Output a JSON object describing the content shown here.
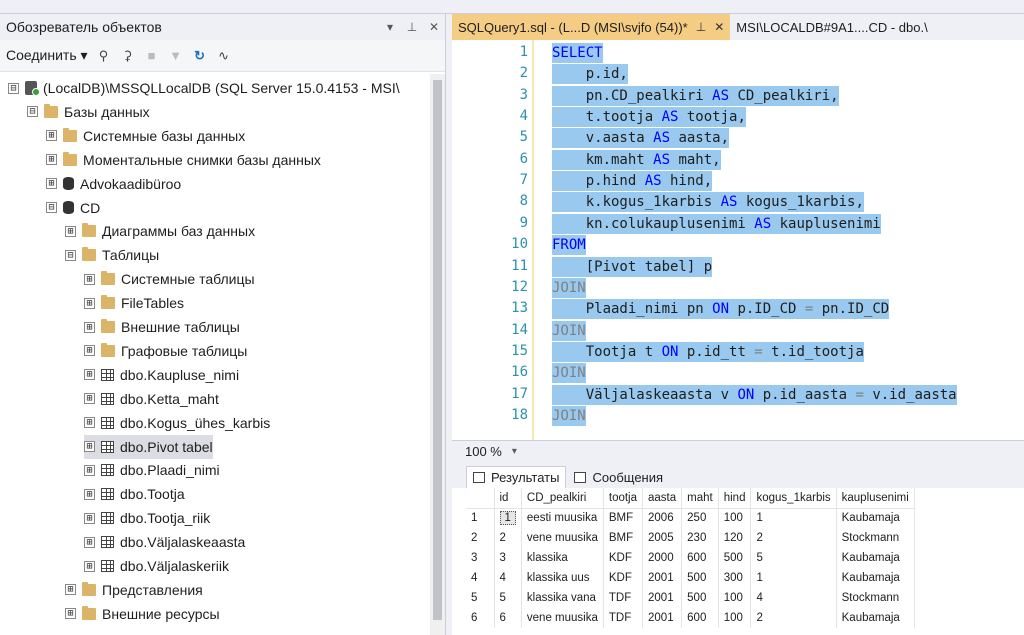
{
  "object_explorer": {
    "title": "Обозреватель объектов",
    "title_controls": [
      "▾",
      "⊥",
      "✕"
    ],
    "toolbar": {
      "connect_label": "Соединить ▾"
    },
    "tree": [
      {
        "label": "(LocalDB)\\MSSQLLocalDB (SQL Server 15.0.4153 - MSI\\",
        "icon": "server-icon",
        "exp": "⊟",
        "indent": 0
      },
      {
        "label": "Базы данных",
        "icon": "folder-icon",
        "exp": "⊟",
        "indent": 1
      },
      {
        "label": "Системные базы данных",
        "icon": "folder-icon",
        "exp": "⊞",
        "indent": 2
      },
      {
        "label": "Моментальные снимки базы данных",
        "icon": "folder-icon",
        "exp": "⊞",
        "indent": 2
      },
      {
        "label": "Advokaadibüroo",
        "icon": "database-icon",
        "exp": "⊞",
        "indent": 2
      },
      {
        "label": "CD",
        "icon": "database-icon",
        "exp": "⊟",
        "indent": 2
      },
      {
        "label": "Диаграммы баз данных",
        "icon": "folder-icon",
        "exp": "⊞",
        "indent": 3
      },
      {
        "label": "Таблицы",
        "icon": "folder-icon",
        "exp": "⊟",
        "indent": 3
      },
      {
        "label": "Системные таблицы",
        "icon": "folder-icon",
        "exp": "⊞",
        "indent": 4
      },
      {
        "label": "FileTables",
        "icon": "folder-icon",
        "exp": "⊞",
        "indent": 4
      },
      {
        "label": "Внешние таблицы",
        "icon": "folder-icon",
        "exp": "⊞",
        "indent": 4
      },
      {
        "label": "Графовые таблицы",
        "icon": "folder-icon",
        "exp": "⊞",
        "indent": 4
      },
      {
        "label": "dbo.Kaupluse_nimi",
        "icon": "table-icon",
        "exp": "⊞",
        "indent": 4
      },
      {
        "label": "dbo.Ketta_maht",
        "icon": "table-icon",
        "exp": "⊞",
        "indent": 4
      },
      {
        "label": "dbo.Kogus_ühes_karbis",
        "icon": "table-icon",
        "exp": "⊞",
        "indent": 4
      },
      {
        "label": "dbo.Pivot tabel",
        "icon": "table-icon",
        "exp": "⊞",
        "indent": 4,
        "selected": true
      },
      {
        "label": "dbo.Plaadi_nimi",
        "icon": "table-icon",
        "exp": "⊞",
        "indent": 4
      },
      {
        "label": "dbo.Tootja",
        "icon": "table-icon",
        "exp": "⊞",
        "indent": 4
      },
      {
        "label": "dbo.Tootja_riik",
        "icon": "table-icon",
        "exp": "⊞",
        "indent": 4
      },
      {
        "label": "dbo.Väljalaskeaasta",
        "icon": "table-icon",
        "exp": "⊞",
        "indent": 4
      },
      {
        "label": "dbo.Väljalaskeriik",
        "icon": "table-icon",
        "exp": "⊞",
        "indent": 4
      },
      {
        "label": "Представления",
        "icon": "folder-icon",
        "exp": "⊞",
        "indent": 3
      },
      {
        "label": "Внешние ресурсы",
        "icon": "folder-icon",
        "exp": "⊞",
        "indent": 3
      }
    ]
  },
  "editor": {
    "tabs": [
      {
        "label": "SQLQuery1.sql - (L...D (MSI\\svjfo (54))*",
        "pin": "⊥",
        "close": "✕",
        "active": true
      },
      {
        "label": "MSI\\LOCALDB#9A1....CD - dbo.\\",
        "active": false
      }
    ],
    "lines": [
      [
        {
          "t": "SELECT",
          "c": "kw"
        }
      ],
      [
        {
          "t": "    p.id,",
          "c": ""
        }
      ],
      [
        {
          "t": "    pn.CD_pealkiri ",
          "c": ""
        },
        {
          "t": "AS",
          "c": "kw"
        },
        {
          "t": " CD_pealkiri,",
          "c": ""
        }
      ],
      [
        {
          "t": "    t.tootja ",
          "c": ""
        },
        {
          "t": "AS",
          "c": "kw"
        },
        {
          "t": " tootja,",
          "c": ""
        }
      ],
      [
        {
          "t": "    v.aasta ",
          "c": ""
        },
        {
          "t": "AS",
          "c": "kw"
        },
        {
          "t": " aasta,",
          "c": ""
        }
      ],
      [
        {
          "t": "    km.maht ",
          "c": ""
        },
        {
          "t": "AS",
          "c": "kw"
        },
        {
          "t": " maht,",
          "c": ""
        }
      ],
      [
        {
          "t": "    p.hind ",
          "c": ""
        },
        {
          "t": "AS",
          "c": "kw"
        },
        {
          "t": " hind,",
          "c": ""
        }
      ],
      [
        {
          "t": "    k.kogus_1karbis ",
          "c": ""
        },
        {
          "t": "AS",
          "c": "kw"
        },
        {
          "t": " kogus_1karbis,",
          "c": ""
        }
      ],
      [
        {
          "t": "    kn.colukauplusenimi ",
          "c": ""
        },
        {
          "t": "AS",
          "c": "kw"
        },
        {
          "t": " kauplusenimi",
          "c": ""
        }
      ],
      [
        {
          "t": "FROM",
          "c": "kw"
        }
      ],
      [
        {
          "t": "    [Pivot tabel] p",
          "c": ""
        }
      ],
      [
        {
          "t": "JOIN",
          "c": "kwg"
        }
      ],
      [
        {
          "t": "    Plaadi_nimi pn ",
          "c": ""
        },
        {
          "t": "ON",
          "c": "kw"
        },
        {
          "t": " p.ID_CD ",
          "c": ""
        },
        {
          "t": "=",
          "c": "op"
        },
        {
          "t": " pn.ID_CD",
          "c": ""
        }
      ],
      [
        {
          "t": "JOIN",
          "c": "kwg"
        }
      ],
      [
        {
          "t": "    Tootja t ",
          "c": ""
        },
        {
          "t": "ON",
          "c": "kw"
        },
        {
          "t": " p.id_tt ",
          "c": ""
        },
        {
          "t": "=",
          "c": "op"
        },
        {
          "t": " t.id_tootja",
          "c": ""
        }
      ],
      [
        {
          "t": "JOIN",
          "c": "kwg"
        }
      ],
      [
        {
          "t": "    Väljalaskeaasta v ",
          "c": ""
        },
        {
          "t": "ON",
          "c": "kw"
        },
        {
          "t": " p.id_aasta ",
          "c": ""
        },
        {
          "t": "=",
          "c": "op"
        },
        {
          "t": " v.id_aasta",
          "c": ""
        }
      ],
      [
        {
          "t": "JOIN",
          "c": "kwg"
        }
      ]
    ],
    "line_numbers": [
      "1",
      "2",
      "3",
      "4",
      "5",
      "6",
      "7",
      "8",
      "9",
      "10",
      "11",
      "12",
      "13",
      "14",
      "15",
      "16",
      "17",
      "18"
    ],
    "zoom": "100 %"
  },
  "results": {
    "tabs": [
      {
        "label": "Результаты",
        "active": true,
        "icon": "grid-icon"
      },
      {
        "label": "Сообщения",
        "active": false,
        "icon": "messages-icon"
      }
    ],
    "columns": [
      "id",
      "CD_pealkiri",
      "tootja",
      "aasta",
      "maht",
      "hind",
      "kogus_1karbis",
      "kauplusenimi"
    ],
    "rows": [
      [
        "1",
        "1",
        "eesti muusika",
        "BMF",
        "2006",
        "250",
        "100",
        "1",
        "Kaubamaja"
      ],
      [
        "2",
        "2",
        "vene muusika",
        "BMF",
        "2005",
        "230",
        "120",
        "2",
        "Stockmann"
      ],
      [
        "3",
        "3",
        "klassika",
        "KDF",
        "2000",
        "600",
        "500",
        "5",
        "Kaubamaja"
      ],
      [
        "4",
        "4",
        "klassika uus",
        "KDF",
        "2001",
        "500",
        "300",
        "1",
        "Kaubamaja"
      ],
      [
        "5",
        "5",
        "klassika vana",
        "TDF",
        "2001",
        "500",
        "100",
        "4",
        "Stockmann"
      ],
      [
        "6",
        "6",
        "vene muusika",
        "TDF",
        "2001",
        "600",
        "100",
        "2",
        "Kaubamaja"
      ]
    ]
  },
  "colors": {
    "selection": "#99c9ef",
    "active_tab": "#f5cc84",
    "keyword": "#0000ff",
    "line_number": "#2b91af"
  }
}
